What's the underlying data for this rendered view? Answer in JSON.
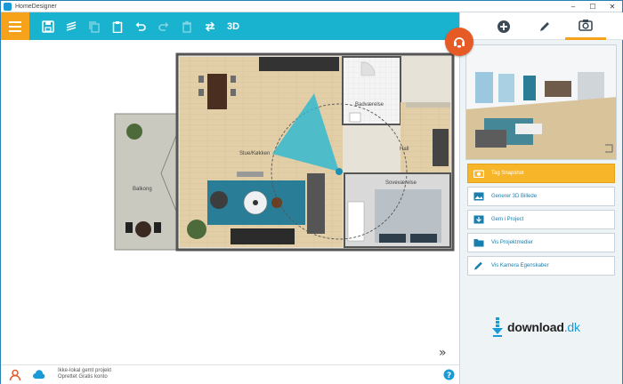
{
  "window": {
    "title": "HomeDesigner"
  },
  "toolbar": {
    "tools": [
      "save-icon",
      "layers-icon",
      "copy-icon",
      "clipboard-icon",
      "undo-icon",
      "redo-icon",
      "delete-icon",
      "swap-icon"
    ],
    "view_3d_label": "3D",
    "accent": "#1ab3cf",
    "menu_color": "#f7a21b"
  },
  "floorplan": {
    "rooms": {
      "living": "Stue/Køkken",
      "bathroom": "Badværelse",
      "hall": "Hall",
      "bedroom": "Soveværelse",
      "balcony": "Balkong"
    }
  },
  "status": {
    "line1": "Ikke-lokal gemt projekt",
    "line2": "Oprettet Gratis konto"
  },
  "right_panel": {
    "tabs": [
      "add-icon",
      "pencil-icon",
      "camera-icon"
    ],
    "active_tab": "camera-icon",
    "actions": [
      {
        "label": "Tag Snapshot",
        "icon": "camera-icon"
      },
      {
        "label": "Generer 3D Billede",
        "icon": "image-icon"
      },
      {
        "label": "Gem i Project",
        "icon": "image-save-icon"
      },
      {
        "label": "Vis Projektmedier",
        "icon": "folder-icon"
      },
      {
        "label": "Vis Kamera Egenskaber",
        "icon": "pencil-icon"
      }
    ],
    "brand": {
      "name": "download",
      "tld": ".dk"
    }
  }
}
